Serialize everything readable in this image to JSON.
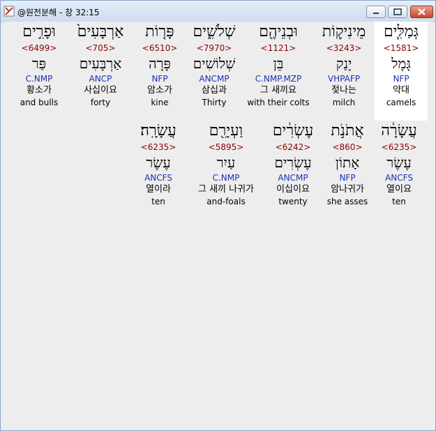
{
  "window": {
    "title": "@원전분해 - 창 32:15"
  },
  "rows": [
    [
      {
        "hebrew": "גְּמַלִּ֧ים",
        "strong": "<1581>",
        "lexeme": "גָּמָל",
        "parse": "NFP",
        "korean": "약대",
        "english": "camels",
        "selected": true
      },
      {
        "hebrew": "מֵינִיק֛וֹת",
        "strong": "<3243>",
        "lexeme": "יָנַק",
        "parse": "VHPAFP",
        "korean": "젖나는",
        "english": "milch",
        "selected": false
      },
      {
        "hebrew": "וּבְנֵיהֶ֖ם",
        "strong": "<1121>",
        "lexeme": "בֵּן",
        "parse": "C.NMP.MZP",
        "korean": "그 새끼요",
        "english": "with their colts",
        "selected": false
      },
      {
        "hebrew": "שְׁלֹשִׁ֑ים",
        "strong": "<7970>",
        "lexeme": "שְׁלוֹשִׁים",
        "parse": "ANCMP",
        "korean": "삼십과",
        "english": "Thirty",
        "selected": false
      },
      {
        "hebrew": "פָּר֤וֹת",
        "strong": "<6510>",
        "lexeme": "פָּרָה",
        "parse": "NFP",
        "korean": "암소가",
        "english": "kine",
        "selected": false
      },
      {
        "hebrew": "אַרְבָּעִים֙",
        "strong": "<705>",
        "lexeme": "אַרְבָּעִים",
        "parse": "ANCP",
        "korean": "사십이요",
        "english": "forty",
        "selected": false
      },
      {
        "hebrew": "וּפָרִ֣ים",
        "strong": "<6499>",
        "lexeme": "פַּר",
        "parse": "C.NMP",
        "korean": "황소가",
        "english": "and bulls",
        "selected": false
      }
    ],
    [
      {
        "hebrew": "עֲשָׂרָ֔ה",
        "strong": "<6235>",
        "lexeme": "עֶשֶׂר",
        "parse": "ANCFS",
        "korean": "열이요",
        "english": "ten",
        "selected": false
      },
      {
        "hebrew": "אֲתֹנֹ֣ת",
        "strong": "<860>",
        "lexeme": "אָתוֹן",
        "parse": "NFP",
        "korean": "암나귀가",
        "english": "she asses",
        "selected": false
      },
      {
        "hebrew": "עֶשְׂרִ֔ים",
        "strong": "<6242>",
        "lexeme": "עֶשְׂרִים",
        "parse": "ANCMP",
        "korean": "이십이요",
        "english": "twenty",
        "selected": false
      },
      {
        "hebrew": "וַעְיָרִ֖ם",
        "strong": "<5895>",
        "lexeme": "עַיִר",
        "parse": "C.NMP",
        "korean": "그 새끼 나귀가",
        "english": "and-foals",
        "selected": false
      },
      {
        "hebrew": "עֲשָׂרָֽה׃",
        "strong": "<6235>",
        "lexeme": "עֶשֶׂר",
        "parse": "ANCFS",
        "korean": "열이라",
        "english": "ten",
        "selected": false
      }
    ]
  ]
}
